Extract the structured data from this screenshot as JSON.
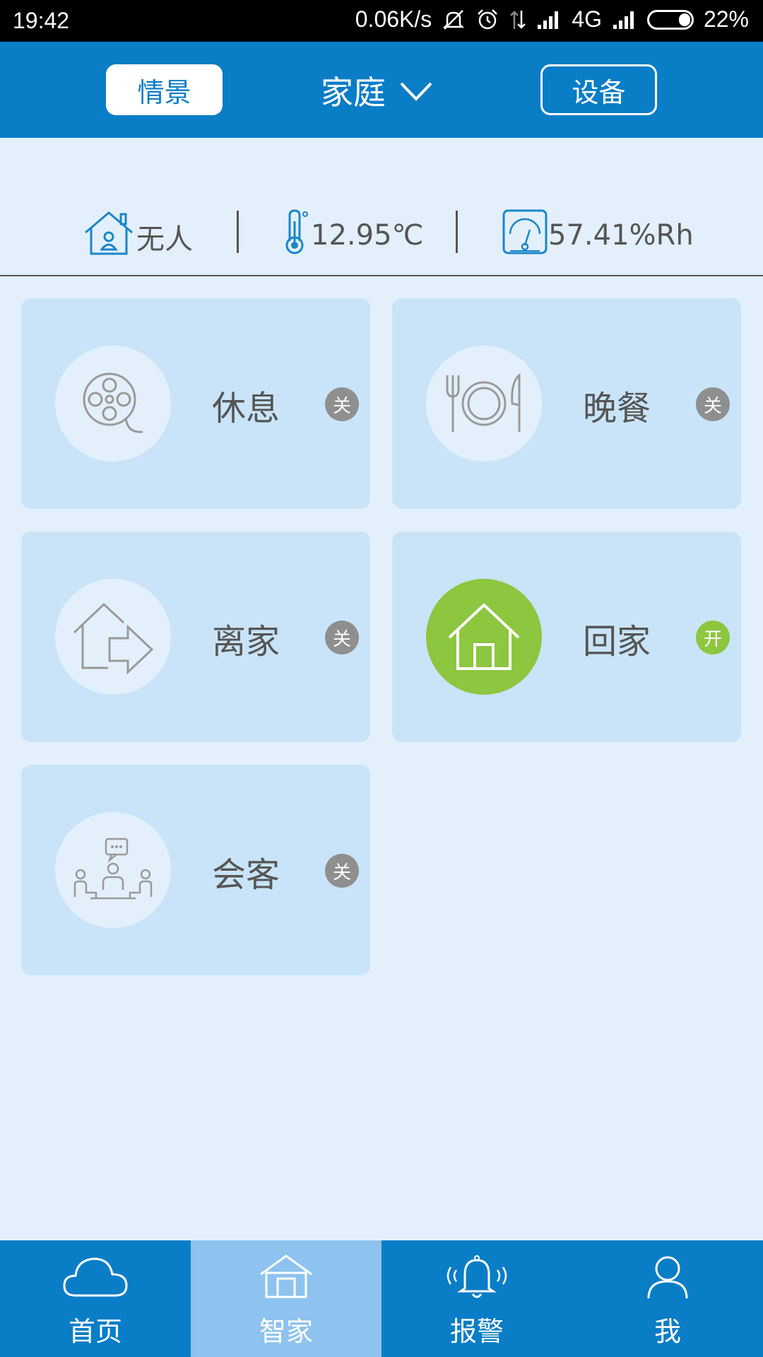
{
  "status_bar": {
    "time": "19:42",
    "network_speed": "0.06K/s",
    "network_type": "4G",
    "battery": "22%"
  },
  "header": {
    "scene_tab": "情景",
    "home_name": "家庭",
    "device_tab": "设备"
  },
  "info": {
    "presence": "无人",
    "temperature": "12.95℃",
    "humidity": "57.41%Rh"
  },
  "scenes": [
    {
      "label": "休息",
      "state": "关",
      "icon": "film-reel-icon",
      "active": false
    },
    {
      "label": "晚餐",
      "state": "关",
      "icon": "dinner-plate-icon",
      "active": false
    },
    {
      "label": "离家",
      "state": "关",
      "icon": "leave-home-icon",
      "active": false
    },
    {
      "label": "回家",
      "state": "开",
      "icon": "home-icon",
      "active": true
    },
    {
      "label": "会客",
      "state": "关",
      "icon": "meeting-icon",
      "active": false
    }
  ],
  "nav": [
    {
      "label": "首页",
      "icon": "cloud-icon"
    },
    {
      "label": "智家",
      "icon": "smart-home-icon"
    },
    {
      "label": "报警",
      "icon": "alarm-bell-icon"
    },
    {
      "label": "我",
      "icon": "user-icon"
    }
  ],
  "colors": {
    "primary": "#0a7dc7",
    "active_green": "#8dc63f",
    "card_bg": "#c9e4f8",
    "page_bg": "#e3f0fb"
  }
}
